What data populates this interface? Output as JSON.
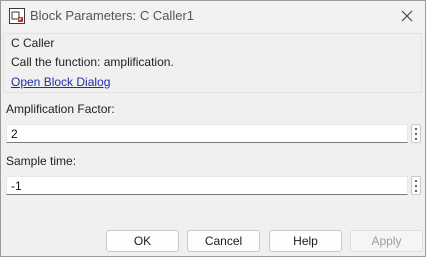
{
  "window": {
    "title": "Block Parameters: C Caller1"
  },
  "group": {
    "title": "C Caller",
    "description": "Call the function: amplification.",
    "link": "Open Block Dialog"
  },
  "fields": {
    "amplification": {
      "label": "Amplification Factor:",
      "value": "2"
    },
    "sample_time": {
      "label": "Sample time:",
      "value": "-1"
    }
  },
  "buttons": {
    "ok": "OK",
    "cancel": "Cancel",
    "help": "Help",
    "apply": "Apply"
  },
  "colors": {
    "link": "#1e2fa4",
    "background": "#f0f0f0",
    "disabled_text": "#9c9c9c"
  },
  "icons": {
    "app": "simulink-block-icon",
    "close": "close-icon",
    "field_menu": "vertical-ellipsis-icon"
  }
}
